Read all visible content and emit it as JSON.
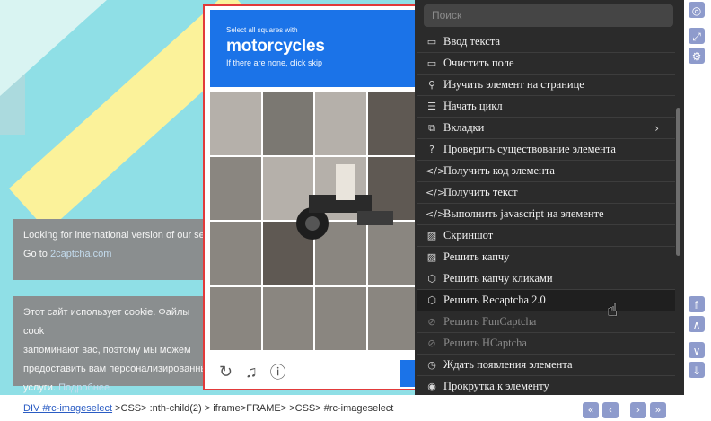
{
  "background": {
    "notice1_line1": "Looking for international version of our se",
    "notice1_line2_prefix": "Go to ",
    "notice1_link": "2captcha.com",
    "notice2_line1": "Этот сайт использует cookie. Файлы cook",
    "notice2_line2": "запоминают вас, поэтому мы можем",
    "notice2_line3": "предоставить вам персонализированны",
    "notice2_line4_prefix": "услуги. ",
    "notice2_link": "Подробнее."
  },
  "captcha": {
    "instruction": "Select all squares with",
    "target": "motorcycles",
    "hint": "If there are none, click skip",
    "footer_icons": [
      "reload-icon",
      "audio-icon",
      "info-icon"
    ]
  },
  "menu": {
    "search_placeholder": "Поиск",
    "items": [
      {
        "label": "Ввод текста",
        "icon": "▭",
        "state": "normal"
      },
      {
        "label": "Очистить поле",
        "icon": "▭",
        "state": "normal"
      },
      {
        "label": "Изучить элемент на странице",
        "icon": "⚲",
        "state": "normal"
      },
      {
        "label": "Начать цикл",
        "icon": "☰",
        "state": "normal"
      },
      {
        "label": "Вкладки",
        "icon": "⧉",
        "state": "submenu"
      },
      {
        "label": "Проверить существование элемента",
        "icon": "?",
        "state": "normal"
      },
      {
        "label": "Получить код элемента",
        "icon": "</>",
        "state": "normal"
      },
      {
        "label": "Получить текст",
        "icon": "</>",
        "state": "normal"
      },
      {
        "label": "Выполнить javascript на элементе",
        "icon": "</>",
        "state": "normal"
      },
      {
        "label": "Скриншот",
        "icon": "▨",
        "state": "normal"
      },
      {
        "label": "Решить капчу",
        "icon": "▨",
        "state": "normal"
      },
      {
        "label": "Решить капчу кликами",
        "icon": "⬡",
        "state": "normal"
      },
      {
        "label": "Решить Recaptcha 2.0",
        "icon": "⬡",
        "state": "hover"
      },
      {
        "label": "Решить FunCaptcha",
        "icon": "⊘",
        "state": "disabled"
      },
      {
        "label": "Решить HCaptcha",
        "icon": "⊘",
        "state": "disabled"
      },
      {
        "label": "Ждать появления элемента",
        "icon": "◷",
        "state": "normal"
      },
      {
        "label": "Прокрутка к элементу",
        "icon": "◉",
        "state": "normal"
      }
    ]
  },
  "statusbar": {
    "link": "DIV #rc-imageselect",
    "rest": " >CSS> :nth-child(2) > iframe>FRAME>  >CSS> #rc-imageselect"
  },
  "right_toolbar": [
    "wifi-icon",
    "expand-icon",
    "settings-icon",
    "top-icon",
    "up-icon",
    "down-icon",
    "bottom-icon"
  ],
  "nav_buttons": [
    "first",
    "prev",
    "next",
    "last"
  ]
}
